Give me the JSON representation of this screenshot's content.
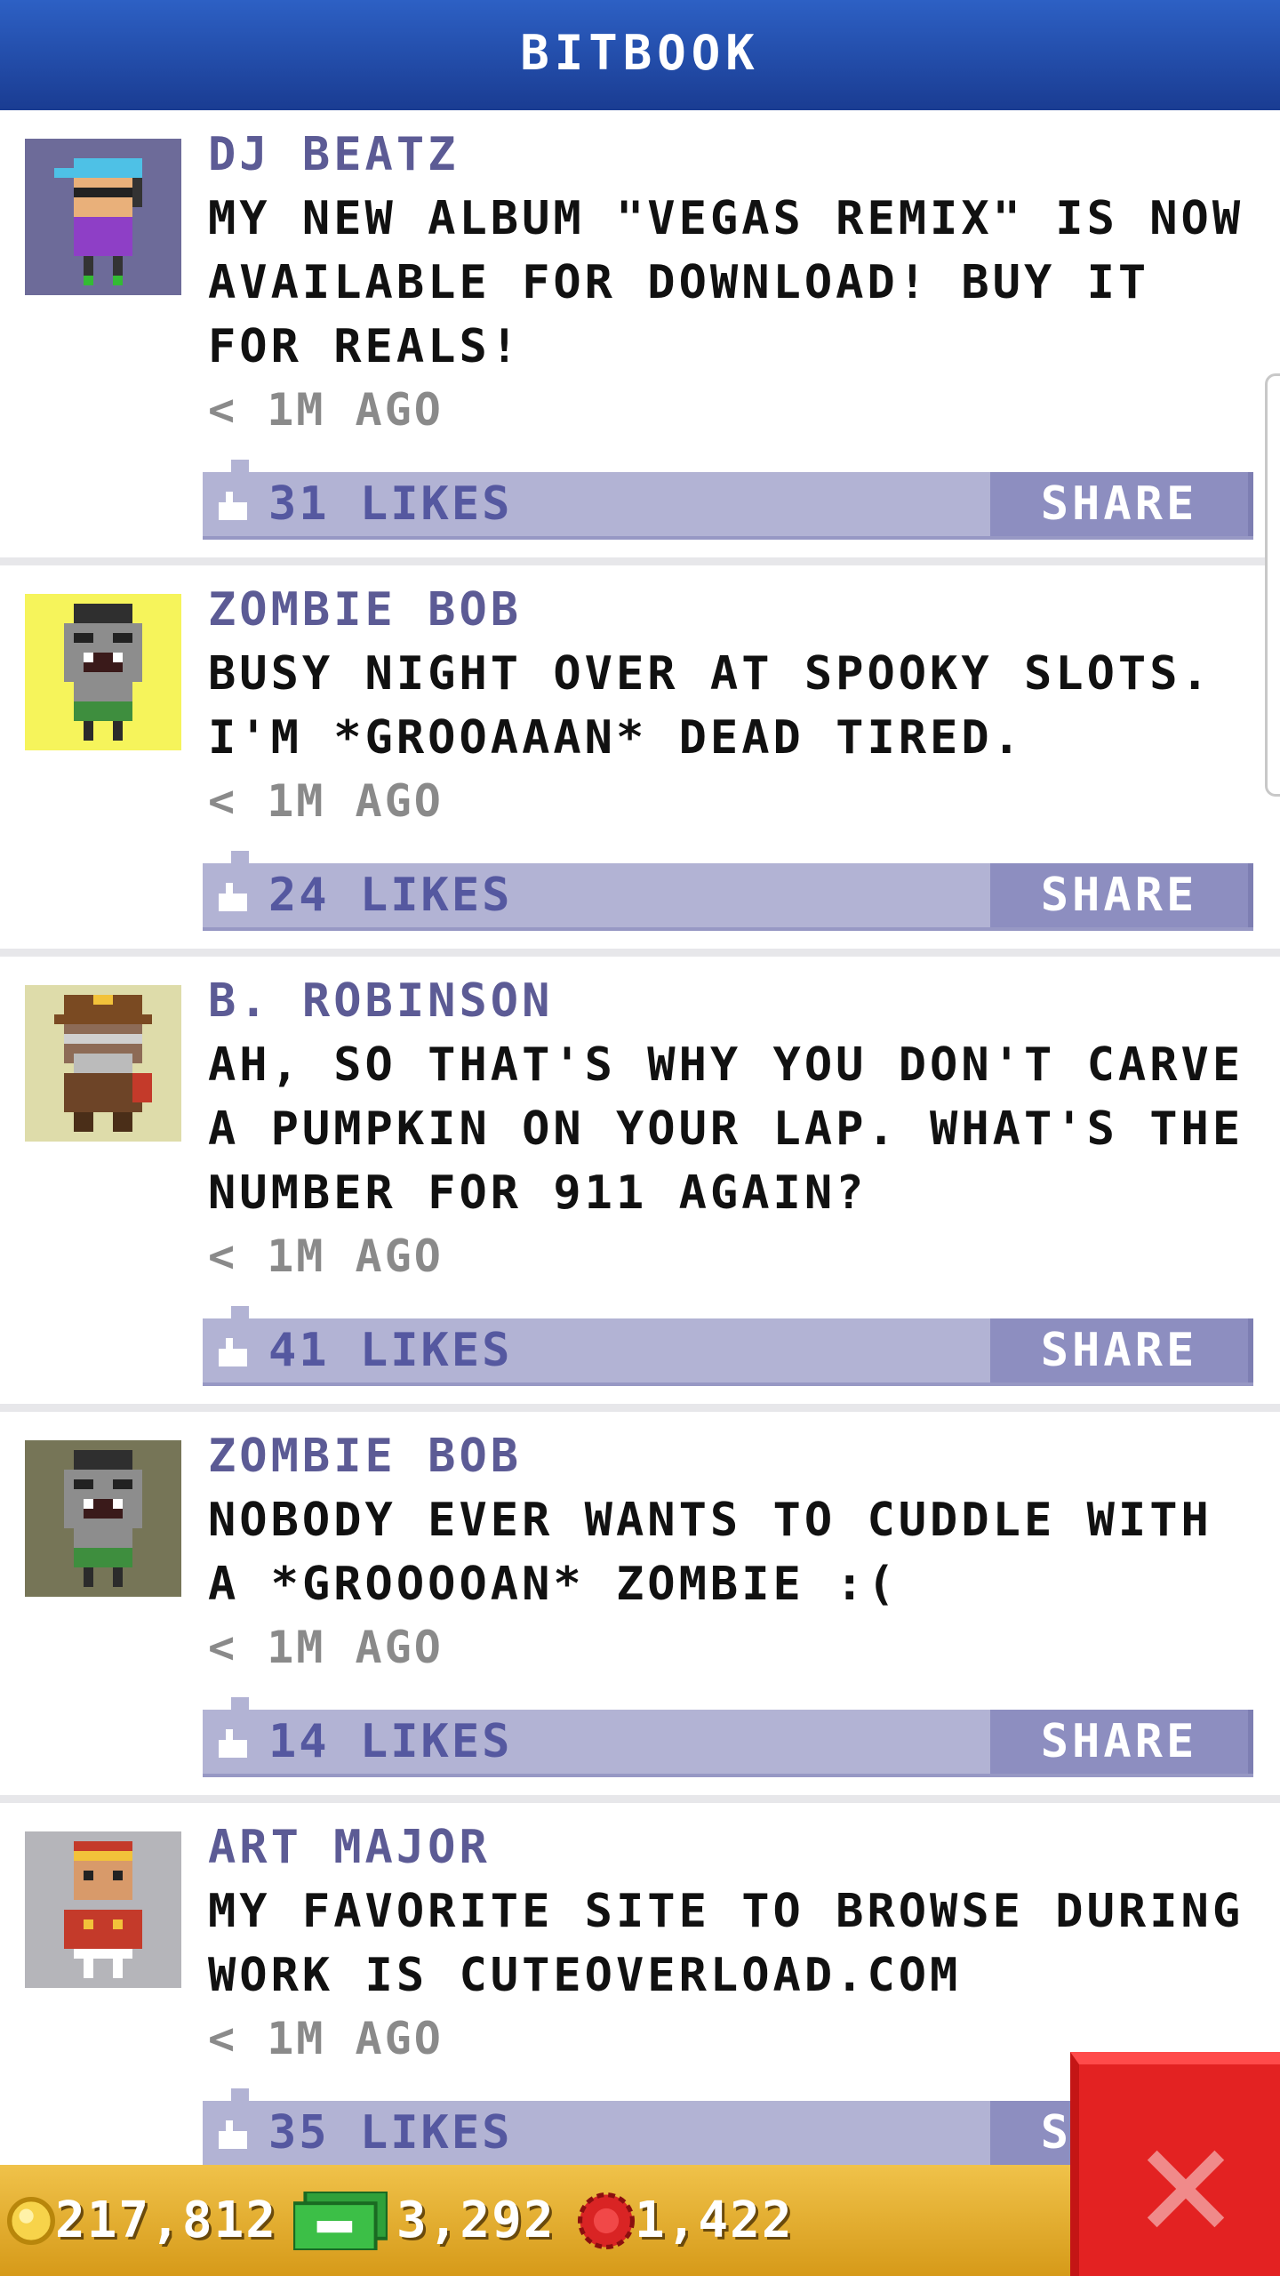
{
  "header": {
    "title": "BITBOOK"
  },
  "posts": [
    {
      "author": "DJ BEATZ",
      "message": "MY NEW ALBUM \"VEGAS REMIX\" IS NOW AVAILABLE FOR DOWNLOAD! BUY IT FOR REALS!",
      "time": "< 1M AGO",
      "likes": "31 LIKES",
      "share_label": "SHARE",
      "avatar_bg": "#6d6b99"
    },
    {
      "author": "ZOMBIE BOB",
      "message": "BUSY NIGHT OVER AT SPOOKY SLOTS. I'M *GROOAAAN* DEAD TIRED.",
      "time": "< 1M AGO",
      "likes": "24 LIKES",
      "share_label": "SHARE",
      "avatar_bg": "#f6f45b"
    },
    {
      "author": "B. ROBINSON",
      "message": "AH, SO THAT'S WHY YOU DON'T CARVE A PUMPKIN ON YOUR LAP. WHAT'S THE NUMBER FOR 911 AGAIN?",
      "time": "< 1M AGO",
      "likes": "41 LIKES",
      "share_label": "SHARE",
      "avatar_bg": "#dedcaa"
    },
    {
      "author": "ZOMBIE BOB",
      "message": "NOBODY EVER WANTS TO CUDDLE WITH A *GROOOOAN* ZOMBIE :(",
      "time": "< 1M AGO",
      "likes": "14 LIKES",
      "share_label": "SHARE",
      "avatar_bg": "#767557"
    },
    {
      "author": "ART MAJOR",
      "message": "MY FAVORITE SITE TO BROWSE DURING WORK IS CUTEOVERLOAD.COM",
      "time": "< 1M AGO",
      "likes": "35 LIKES",
      "share_label": "SHARE",
      "avatar_bg": "#b5b5ba"
    }
  ],
  "currencies": {
    "coins": "217,812",
    "bux": "3,292",
    "tokens": "1,422"
  },
  "colors": {
    "header_blue": "#1f4aa8",
    "like_bar": "#b2b3d4",
    "share_button": "#8d8ec0",
    "bottom_bar": "#e2ae2c",
    "close_red": "#e32222"
  },
  "icons": {
    "like": "thumbs-up-icon",
    "coin": "coin-icon",
    "bux": "bux-icon",
    "token": "token-icon",
    "close": "close-icon"
  }
}
